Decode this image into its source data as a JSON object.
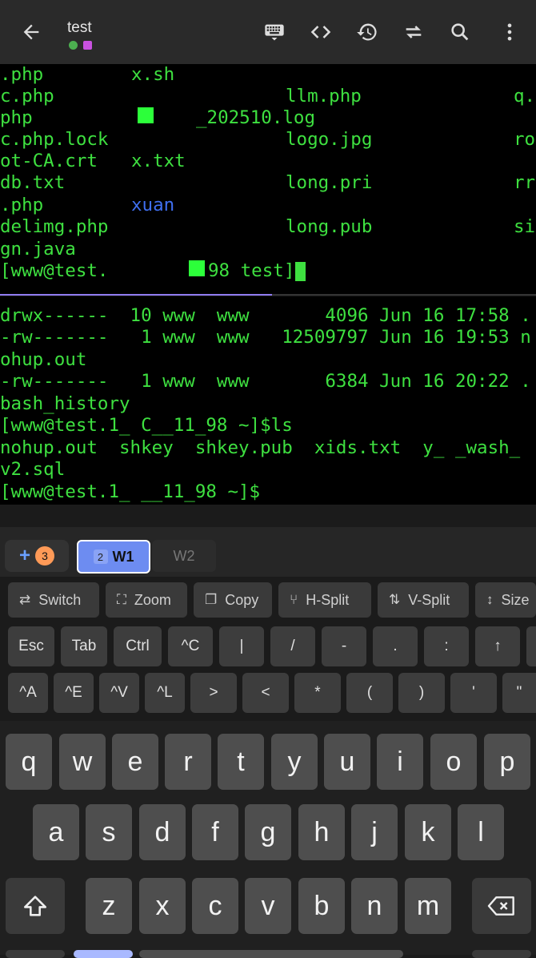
{
  "header": {
    "title": "test",
    "icons": [
      "back-arrow-icon",
      "keyboard-icon",
      "code-icon",
      "history-icon",
      "swap-icon",
      "search-icon",
      "more-vert-icon"
    ]
  },
  "terminal_top": {
    "lines": [
      {
        "c1": ".php",
        "c2": "x.sh",
        "c3": "",
        "c4": ""
      },
      {
        "c1": "c.php",
        "c2": "",
        "c3": "llm.php",
        "c4": "q."
      },
      {
        "c1": "php",
        "c2": "_202510.log",
        "c3": "",
        "c4": ""
      },
      {
        "c1": "c.php.lock",
        "c2": "",
        "c3": "logo.jpg",
        "c4": "ro"
      },
      {
        "c1": "ot-CA.crt",
        "c2": "x.txt",
        "c3": "",
        "c4": ""
      },
      {
        "c1": "db.txt",
        "c2": "",
        "c3": "long.pri",
        "c4": "rr"
      },
      {
        "c1": ".php",
        "c2": "xuan",
        "c3": "",
        "c4": ""
      },
      {
        "c1": "delimg.php",
        "c2": "",
        "c3": "long.pub",
        "c4": "si"
      },
      {
        "c1": "gn.java",
        "c2": "",
        "c3": "",
        "c4": ""
      }
    ],
    "prompt_pre": "[www@test.",
    "prompt_post": "98 test]$"
  },
  "terminal_bottom": {
    "lines": [
      "drwx------  10 www  www       4096 Jun 16 17:58 .",
      "-rw-------   1 www  www   12509797 Jun 16 19:53 n",
      "ohup.out",
      "-rw-------   1 www  www       6384 Jun 16 20:22 .",
      "bash_history",
      "[www@test.1_ C__11_98 ~]$ls",
      "nohup.out  shkey  shkey.pub  xids.txt  y_ _wash_",
      "v2.sql",
      "[www@test.1_ __11_98 ~]$"
    ]
  },
  "tabs": {
    "add_badge": "3",
    "w1_num": "2",
    "w1_label": "W1",
    "w2_label": "W2"
  },
  "actions": [
    {
      "label": "Switch",
      "icon": "⇄"
    },
    {
      "label": "Zoom",
      "icon": "⛶"
    },
    {
      "label": "Copy",
      "icon": "❐"
    },
    {
      "label": "H-Split",
      "icon": "⑂"
    },
    {
      "label": "V-Split",
      "icon": "⇅"
    },
    {
      "label": "Size",
      "icon": "↕"
    }
  ],
  "keys_row1": [
    "Esc",
    "Tab",
    "Ctrl",
    "^C",
    "|",
    "/",
    "-",
    ".",
    ":",
    "↑"
  ],
  "keys_row2": [
    "^A",
    "^E",
    "^V",
    "^L",
    ">",
    "<",
    "*",
    "(",
    ")",
    "'",
    "\""
  ],
  "keyboard": {
    "row1": [
      "q",
      "w",
      "e",
      "r",
      "t",
      "y",
      "u",
      "i",
      "o",
      "p"
    ],
    "row2": [
      "a",
      "s",
      "d",
      "f",
      "g",
      "h",
      "j",
      "k",
      "l"
    ],
    "row3": [
      "z",
      "x",
      "c",
      "v",
      "b",
      "n",
      "m"
    ]
  }
}
